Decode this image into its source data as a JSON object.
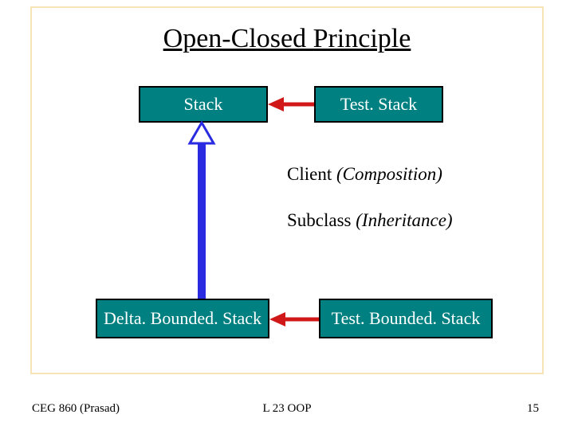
{
  "title": "Open-Closed Principle",
  "boxes": {
    "stack": "Stack",
    "teststack": "Test. Stack",
    "deltabounded": "Delta. Bounded. Stack",
    "testbounded": "Test. Bounded. Stack"
  },
  "labels": {
    "client_word": "Client  ",
    "client_paren": "(Composition)",
    "subclass_word": "Subclass ",
    "subclass_paren": "(Inheritance)"
  },
  "footer": {
    "left": "CEG 860  (Prasad)",
    "center": "L 23 OOP",
    "right": "15"
  },
  "colors": {
    "box_fill": "#008080",
    "arrow_red": "#d01818",
    "arrow_blue": "#2a2ae0"
  }
}
